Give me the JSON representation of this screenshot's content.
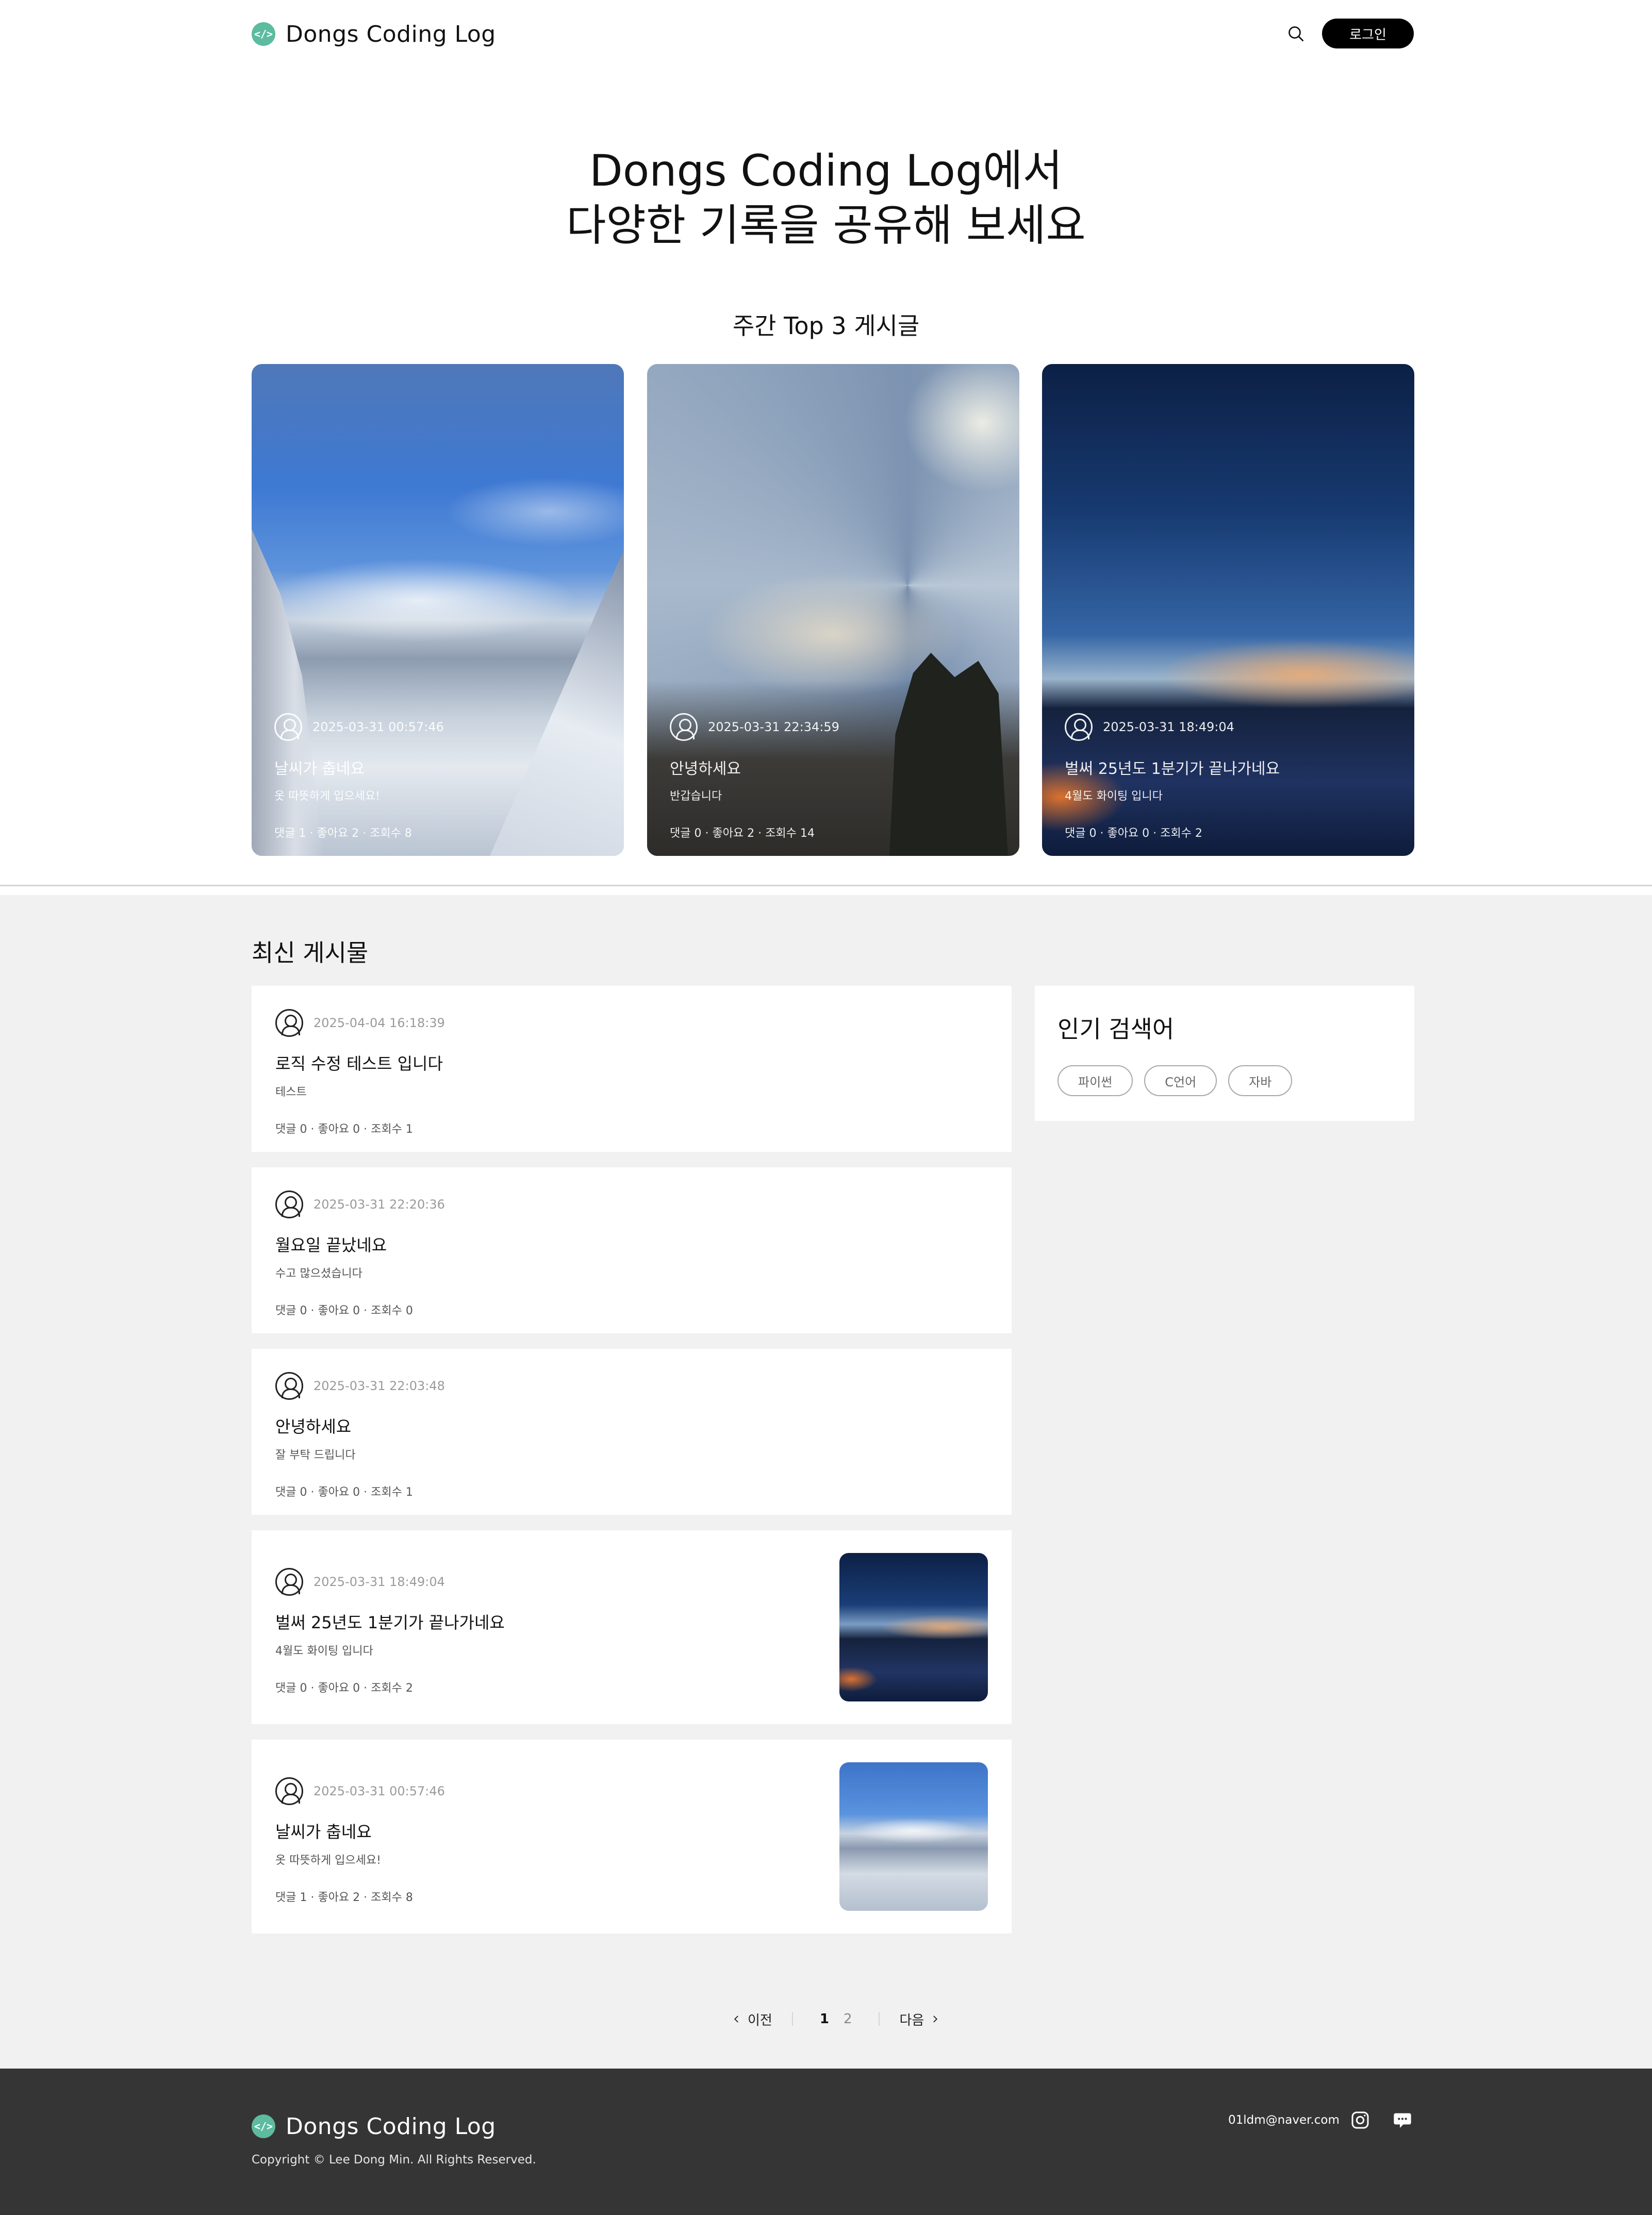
{
  "header": {
    "brand_icon": "</>",
    "brand": "Dongs Coding Log",
    "search_icon": "search-icon",
    "login_label": "로그인"
  },
  "hero": {
    "line1": "Dongs Coding Log에서",
    "line2": "다양한 기록을 공유해 보세요"
  },
  "top3": {
    "title": "주간 Top 3 게시글",
    "posts": [
      {
        "date": "2025-03-31 00:57:46",
        "title": "날씨가 춥네요",
        "subtitle": "옷 따뜻하게 입으세요!",
        "stats": "댓글 1 · 좋아요 2 · 조회수 8",
        "image": "snowy-mountain-photo"
      },
      {
        "date": "2025-03-31 22:34:59",
        "title": "안녕하세요",
        "subtitle": "반갑습니다",
        "stats": "댓글 0 · 좋아요 2 · 조회수 14",
        "image": "sun-rays-sky-photo"
      },
      {
        "date": "2025-03-31 18:49:04",
        "title": "벌써 25년도 1분기가 끝나가네요",
        "subtitle": "4월도 화이팅 입니다",
        "stats": "댓글 0 · 좋아요 0 · 조회수 2",
        "image": "sunset-snow-photo"
      }
    ]
  },
  "latest": {
    "title": "최신 게시물",
    "posts": [
      {
        "date": "2025-04-04 16:18:39",
        "title": "로직 수정 테스트 입니다",
        "subtitle": "테스트",
        "stats": "댓글 0 · 좋아요 0 · 조회수 1"
      },
      {
        "date": "2025-03-31 22:20:36",
        "title": "월요일 끝났네요",
        "subtitle": "수고 많으셨습니다",
        "stats": "댓글 0 · 좋아요 0 · 조회수 0"
      },
      {
        "date": "2025-03-31 22:03:48",
        "title": "안녕하세요",
        "subtitle": "잘 부탁 드립니다",
        "stats": "댓글 0 · 좋아요 0 · 조회수 1"
      },
      {
        "date": "2025-03-31 18:49:04",
        "title": "벌써 25년도 1분기가 끝나가네요",
        "subtitle": "4월도 화이팅 입니다",
        "stats": "댓글 0 · 좋아요 0 · 조회수 2",
        "image": "sunset-snow-thumbnail"
      },
      {
        "date": "2025-03-31 00:57:46",
        "title": "날씨가 춥네요",
        "subtitle": "옷 따뜻하게 입으세요!",
        "stats": "댓글 1 · 좋아요 2 · 조회수 8",
        "image": "snowy-mountain-thumbnail"
      }
    ]
  },
  "popular": {
    "title": "인기 검색어",
    "tags": [
      "파이썬",
      "C언어",
      "자바"
    ]
  },
  "pagination": {
    "prev": "이전",
    "pages": [
      "1",
      "2"
    ],
    "current": "1",
    "next": "다음"
  },
  "footer": {
    "brand": "Dongs Coding Log",
    "copyright": "Copyright © Lee Dong Min. All Rights Reserved.",
    "email": "01ldm@naver.com",
    "icons": [
      "instagram-icon",
      "chat-icon"
    ]
  },
  "colors": {
    "brand_green": "#5dbb9f",
    "login_bg": "#000000",
    "section_bg": "#f1f1f1",
    "footer_bg": "#353535"
  }
}
